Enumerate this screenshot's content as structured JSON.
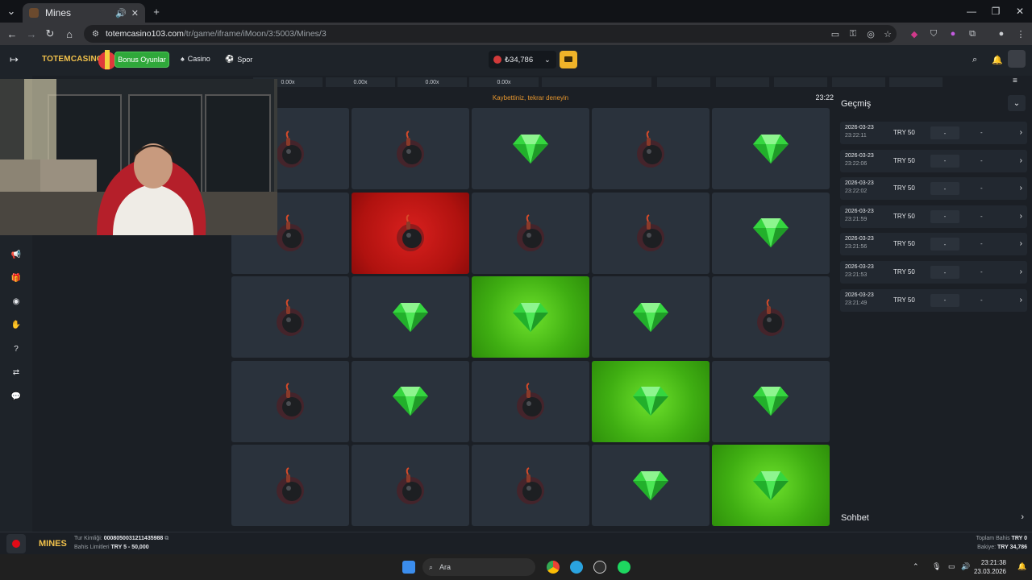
{
  "browser": {
    "tab_title": "Mines",
    "url_host": "totemcasino103.com",
    "url_path": "/tr/game/iframe/iMoon/3:5003/Mines/3"
  },
  "site": {
    "logo": "TOTEMCASINO",
    "bonus_label": "Bonus Oyunlar",
    "nav": [
      "Casino",
      "Spor"
    ],
    "balance": "₺34,786"
  },
  "game": {
    "multipliers": [
      "0.00x",
      "0.00x",
      "0.00x",
      "0.00x",
      "",
      "",
      "",
      "",
      "",
      "",
      ""
    ],
    "status": "Kaybettiniz, tekrar deneyin",
    "clock": "23:22",
    "grid": [
      [
        "bomb",
        "bomb",
        "gem",
        "bomb",
        "gem"
      ],
      [
        "bomb",
        "bomb-hit",
        "bomb",
        "bomb",
        "gem"
      ],
      [
        "bomb",
        "gem",
        "gem-picked",
        "gem",
        "bomb"
      ],
      [
        "bomb",
        "gem",
        "bomb",
        "gem-picked",
        "gem"
      ],
      [
        "bomb",
        "bomb",
        "bomb",
        "gem",
        "gem-picked"
      ]
    ]
  },
  "history": {
    "title": "Geçmiş",
    "rows": [
      {
        "date": "2026-03-23",
        "time": "23:22:11",
        "amount": "TRY 50",
        "mult": "-",
        "profit": "-"
      },
      {
        "date": "2026-03-23",
        "time": "23:22:06",
        "amount": "TRY 50",
        "mult": "-",
        "profit": "-"
      },
      {
        "date": "2026-03-23",
        "time": "23:22:02",
        "amount": "TRY 50",
        "mult": "-",
        "profit": "-"
      },
      {
        "date": "2026-03-23",
        "time": "23:21:59",
        "amount": "TRY 50",
        "mult": "-",
        "profit": "-"
      },
      {
        "date": "2026-03-23",
        "time": "23:21:56",
        "amount": "TRY 50",
        "mult": "-",
        "profit": "-"
      },
      {
        "date": "2026-03-23",
        "time": "23:21:53",
        "amount": "TRY 50",
        "mult": "-",
        "profit": "-"
      },
      {
        "date": "2026-03-23",
        "time": "23:21:49",
        "amount": "TRY 50",
        "mult": "-",
        "profit": "-"
      }
    ]
  },
  "chat": {
    "title": "Sohbet"
  },
  "footer": {
    "game_logo": "MINES",
    "round_id_label": "Tur Kimliği:",
    "round_id": "0008050031211435988",
    "limits_label": "Bahis Limitleri",
    "limits": "TRY 5 - 50,000",
    "total_bet_label": "Toplam Bahis",
    "total_bet": "TRY 0",
    "balance_label": "Bakiye:",
    "balance": "TRY 34,786"
  },
  "taskbar": {
    "search_placeholder": "Ara",
    "time": "23:21:38",
    "date": "23.03.2026"
  },
  "colors": {
    "gem": "#3ee04a",
    "won_tile": "#4cc319",
    "lost_tile": "#c4130f",
    "status": "#e6962e",
    "accent": "#f0b429"
  }
}
